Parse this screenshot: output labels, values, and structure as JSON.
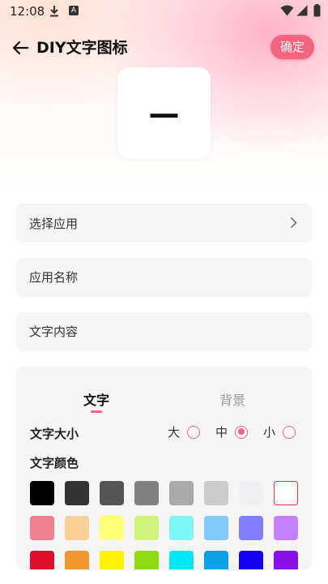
{
  "status_bar": {
    "time": "12:08",
    "download_icon": "download-icon",
    "app_icon_letter": "A",
    "wifi_icon": "wifi-icon",
    "cell_icon": "cellular-icon",
    "battery_icon": "battery-icon"
  },
  "header": {
    "title": "DIY文字图标",
    "confirm_label": "确定",
    "back_icon": "arrow-back-icon"
  },
  "preview": {
    "text": "—"
  },
  "fields": {
    "select_app": "选择应用",
    "app_name_placeholder": "应用名称",
    "text_content_placeholder": "文字内容"
  },
  "panel": {
    "tabs": [
      {
        "label": "文字",
        "active": true
      },
      {
        "label": "背景",
        "active": false
      }
    ],
    "text_size": {
      "label": "文字大小",
      "options": [
        {
          "label": "大",
          "selected": false
        },
        {
          "label": "中",
          "selected": true
        },
        {
          "label": "小",
          "selected": false
        }
      ]
    },
    "text_color": {
      "label": "文字颜色",
      "selected_index": 7,
      "colors": [
        "#000000",
        "#333333",
        "#555555",
        "#808080",
        "#aaaaaa",
        "#cccccc",
        "#f0f0f4",
        "#ffffff",
        "#ee8090",
        "#fbd098",
        "#ffff7a",
        "#cdf37a",
        "#7df7f6",
        "#7ecbf7",
        "#8080ff",
        "#c57fff",
        "#e0102a",
        "#f0962e",
        "#fff200",
        "#8cdc10",
        "#00e6f5",
        "#10a0e8",
        "#1400f0",
        "#8c10e8"
      ]
    }
  },
  "accent_color": "#f5647f"
}
